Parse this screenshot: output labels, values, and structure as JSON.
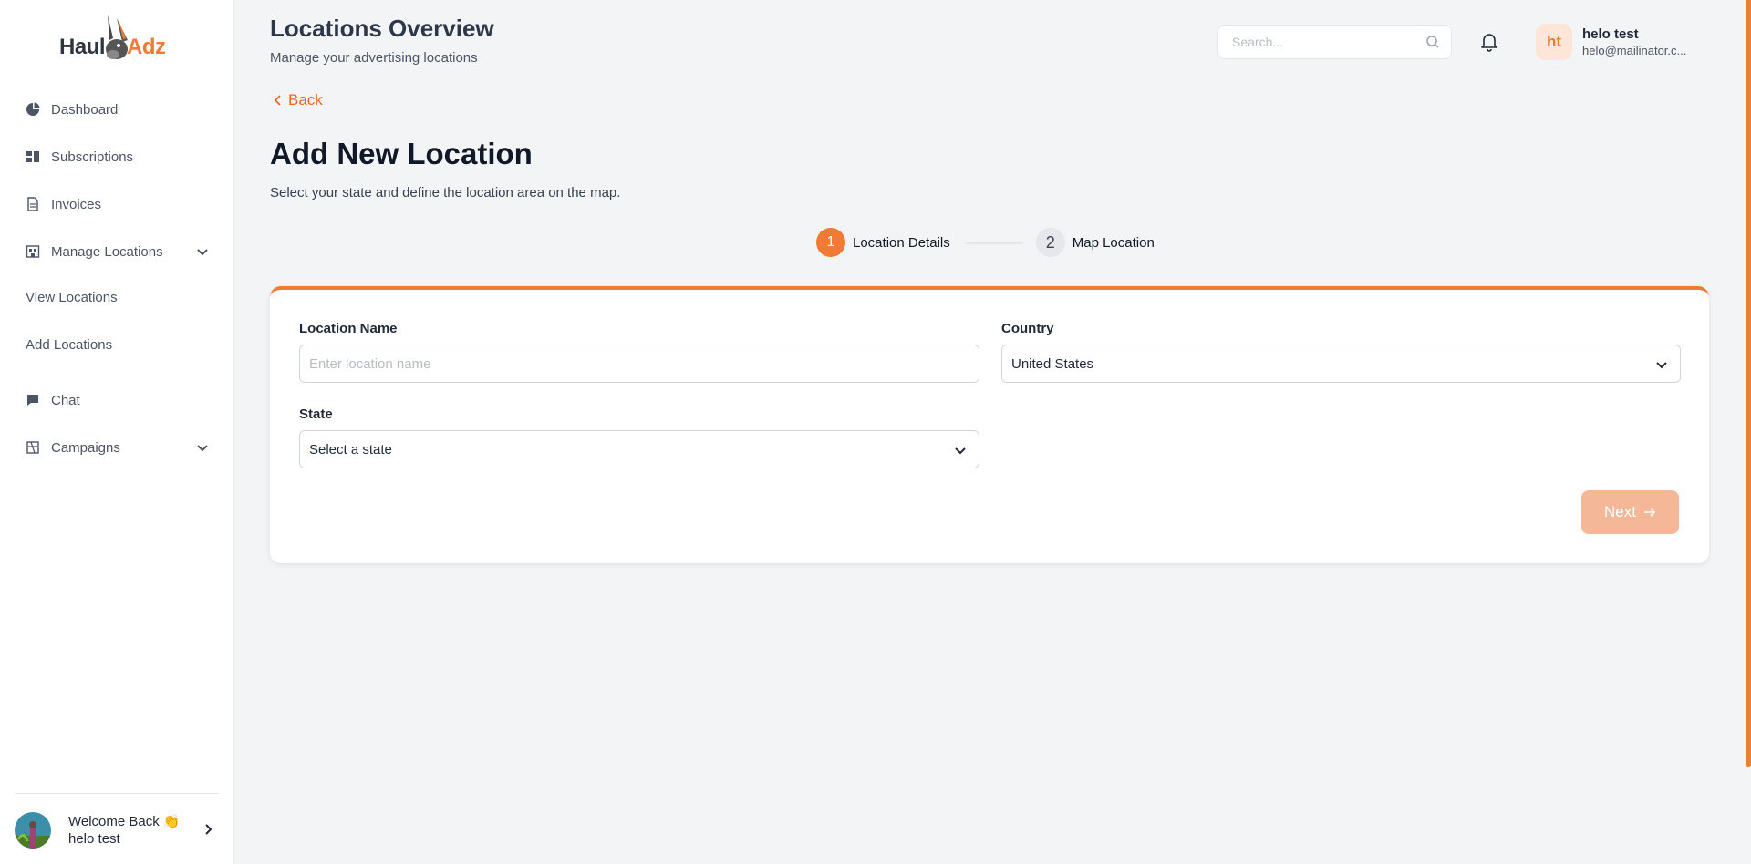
{
  "brand": {
    "name_part1": "Haul",
    "name_part2": "Adz",
    "accent_color": "#ef7b35"
  },
  "sidebar": {
    "items": [
      {
        "label": "Dashboard",
        "icon": "pie-chart-icon"
      },
      {
        "label": "Subscriptions",
        "icon": "grid-icon"
      },
      {
        "label": "Invoices",
        "icon": "document-icon"
      },
      {
        "label": "Manage Locations",
        "icon": "building-icon",
        "expanded": true
      },
      {
        "label": "Chat",
        "icon": "chat-icon"
      },
      {
        "label": "Campaigns",
        "icon": "box-icon",
        "expanded": false
      }
    ],
    "sub_items": [
      "View Locations",
      "Add Locations"
    ],
    "footer": {
      "welcome": "Welcome Back 👏",
      "user": "helo test"
    }
  },
  "header": {
    "title": "Locations Overview",
    "subtitle": "Manage your advertising locations",
    "search_placeholder": "Search...",
    "user_initials": "ht",
    "user_name": "helo test",
    "user_email": "helo@mailinator.c..."
  },
  "page": {
    "back_label": "Back",
    "title": "Add New Location",
    "description": "Select your state and define the location area on the map."
  },
  "stepper": {
    "steps": [
      {
        "number": "1",
        "label": "Location Details",
        "active": true
      },
      {
        "number": "2",
        "label": "Map Location",
        "active": false
      }
    ]
  },
  "form": {
    "location_name_label": "Location Name",
    "location_name_placeholder": "Enter location name",
    "location_name_value": "",
    "country_label": "Country",
    "country_value": "United States",
    "state_label": "State",
    "state_value": "Select a state",
    "next_label": "Next"
  }
}
